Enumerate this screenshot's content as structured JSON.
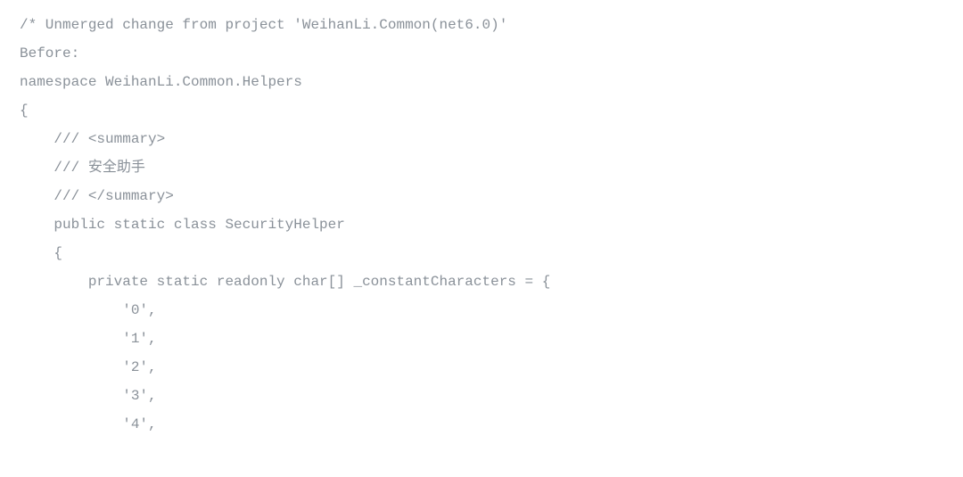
{
  "lines": [
    "/* Unmerged change from project 'WeihanLi.Common(net6.0)'",
    "Before:",
    "namespace WeihanLi.Common.Helpers",
    "{",
    "    /// <summary>",
    "    /// 安全助手",
    "    /// </summary>",
    "    public static class SecurityHelper",
    "    {",
    "        private static readonly char[] _constantCharacters = {",
    "            '0',",
    "            '1',",
    "            '2',",
    "            '3',",
    "            '4',"
  ]
}
